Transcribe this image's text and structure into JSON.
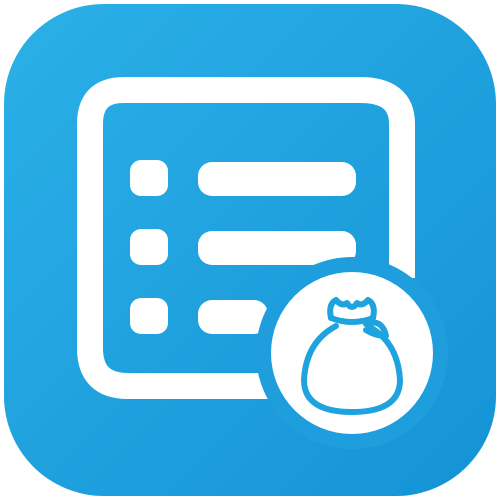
{
  "app_icon": {
    "name": "list-with-money-bag",
    "icon_names": [
      "list-icon",
      "money-bag-icon"
    ],
    "colors": {
      "background_top": "#2bb0e8",
      "background_bottom": "#1593d5",
      "foreground": "#ffffff",
      "accent": "#1da4df"
    }
  }
}
